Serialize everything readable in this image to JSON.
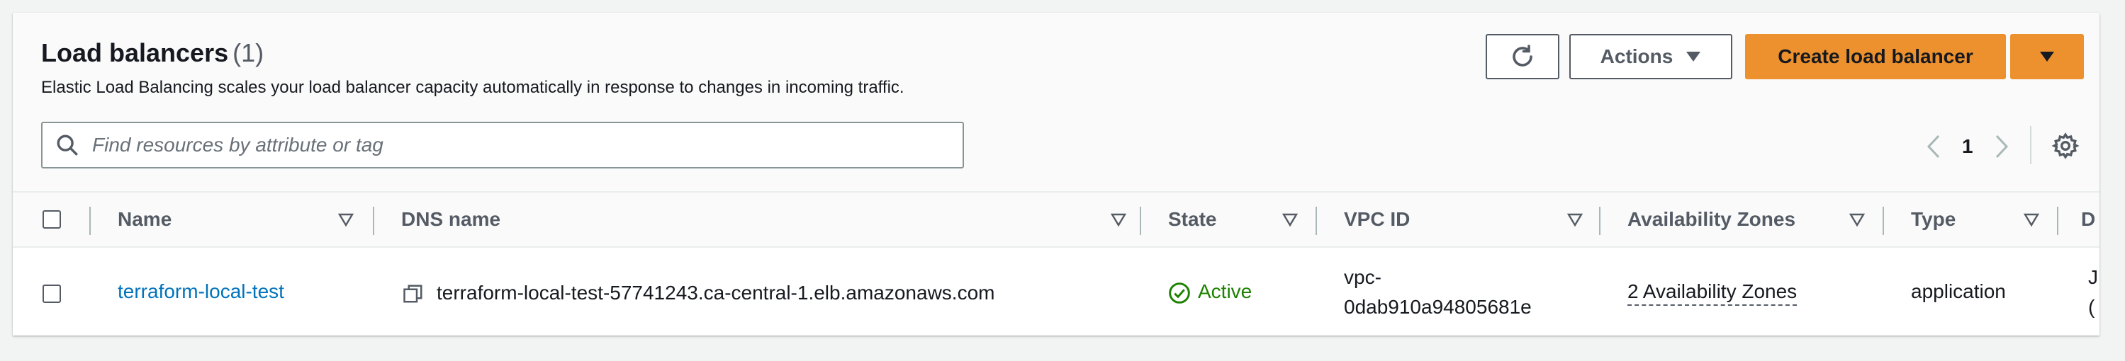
{
  "header": {
    "title": "Load balancers",
    "count": "(1)",
    "description": "Elastic Load Balancing scales your load balancer capacity automatically in response to changes in incoming traffic."
  },
  "toolbar": {
    "refresh_icon": "refresh-icon",
    "actions_label": "Actions",
    "create_label": "Create load balancer"
  },
  "search": {
    "placeholder": "Find resources by attribute or tag",
    "value": ""
  },
  "pagination": {
    "current_page": "1"
  },
  "table": {
    "columns": [
      {
        "label": "Name"
      },
      {
        "label": "DNS name"
      },
      {
        "label": "State"
      },
      {
        "label": "VPC ID"
      },
      {
        "label": "Availability Zones"
      },
      {
        "label": "Type"
      },
      {
        "label": "D"
      }
    ],
    "rows": [
      {
        "name": "terraform-local-test",
        "dns_name": "terraform-local-test-57741243.ca-central-1.elb.amazonaws.com",
        "state": "Active",
        "vpc_id_line1": "vpc-",
        "vpc_id_line2": "0dab910a94805681e",
        "availability_zones": "2 Availability Zones",
        "type": "application",
        "date_partial_1": "J",
        "date_partial_2": "("
      }
    ]
  },
  "colors": {
    "primary_button": "#ec912d",
    "link": "#0073bb",
    "success": "#1d8102"
  }
}
